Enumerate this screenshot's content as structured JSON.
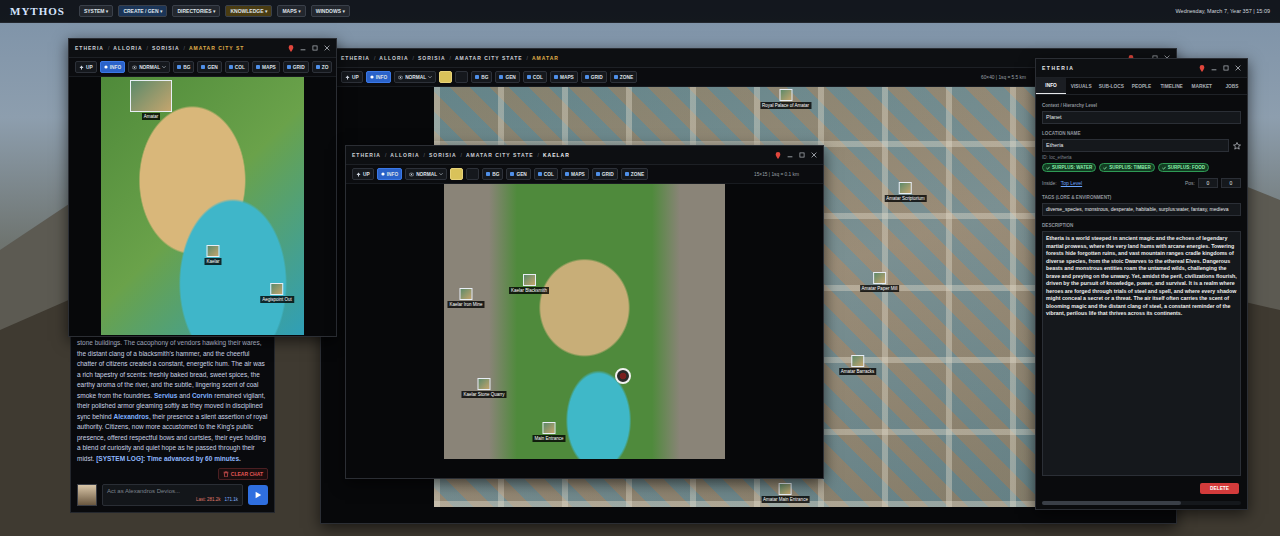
{
  "menubar": {
    "logo": "MYTHOS",
    "menus": [
      {
        "label": "SYSTEM ▾",
        "color": "#23272e"
      },
      {
        "label": "CREATE / GEN ▾",
        "color": "#1b3558"
      },
      {
        "label": "DIRECTORIES ▾",
        "color": "#23272e"
      },
      {
        "label": "KNOWLEDGE ▾",
        "color": "#4a3c12"
      },
      {
        "label": "MAPS ▾",
        "color": "#23272e"
      },
      {
        "label": "WINDOWS ▾",
        "color": "#23272e"
      }
    ],
    "clock": "Wednesday, March 7, Year 357 | 15:09"
  },
  "map_windows": [
    {
      "separator": "/",
      "crumbs": [
        "ETHERIA",
        "ALLORIA",
        "SORISIA",
        "AMATAR CITY ST"
      ],
      "toolbar": [
        {
          "label": "UP",
          "kind": "nav",
          "selected": false
        },
        {
          "label": "INFO",
          "kind": "toggle",
          "selected": true
        },
        {
          "label": "NORMAL",
          "kind": "dropdown",
          "selected": false
        },
        {
          "label": "BG",
          "kind": "tool",
          "selected": false
        },
        {
          "label": "GEN",
          "kind": "tool",
          "selected": false
        },
        {
          "label": "COL",
          "kind": "tool",
          "selected": false
        },
        {
          "label": "MAPS",
          "kind": "tool",
          "selected": false
        },
        {
          "label": "GRID",
          "kind": "tool",
          "selected": false
        },
        {
          "label": "ZO",
          "kind": "tool",
          "selected": false
        }
      ],
      "pins": [
        {
          "kind": "place",
          "label": "Amatar"
        },
        {
          "kind": "place",
          "label": "Kaelar"
        },
        {
          "kind": "place",
          "label": "Aegispoint Out"
        }
      ]
    },
    {
      "separator": "/",
      "crumbs": [
        "ETHERIA",
        "ALLORIA",
        "SORISIA",
        "AMATAR CITY STATE",
        "AMATAR"
      ],
      "toolbar": [
        {
          "label": "UP",
          "kind": "nav",
          "selected": false
        },
        {
          "label": "INFO",
          "kind": "toggle",
          "selected": true
        },
        {
          "label": "NORMAL",
          "kind": "dropdown",
          "selected": false
        },
        {
          "label": "",
          "kind": "icon",
          "selected": true
        },
        {
          "label": "",
          "kind": "icon",
          "selected": false
        },
        {
          "label": "BG",
          "kind": "tool",
          "selected": false
        },
        {
          "label": "GEN",
          "kind": "tool",
          "selected": false
        },
        {
          "label": "COL",
          "kind": "tool",
          "selected": false
        },
        {
          "label": "MAPS",
          "kind": "tool",
          "selected": false
        },
        {
          "label": "GRID",
          "kind": "tool",
          "selected": false
        },
        {
          "label": "ZONE",
          "kind": "tool",
          "selected": false
        }
      ],
      "scale": "60×40 | 1sq = 5.5 km",
      "pins": [
        {
          "kind": "place",
          "label": "Royal Palace of Amatar"
        },
        {
          "kind": "place",
          "label": "Amatar Scriptorium"
        },
        {
          "kind": "place",
          "label": "Amatar Paper Mill"
        },
        {
          "kind": "place",
          "label": "Amatar Barracks"
        },
        {
          "kind": "place",
          "label": "Amatar Main Entrance"
        }
      ]
    },
    {
      "separator": "/",
      "crumbs": [
        "ETHERIA",
        "ALLORIA",
        "SORISIA",
        "AMATAR CITY STATE",
        "KAELAR"
      ],
      "toolbar": [
        {
          "label": "UP",
          "kind": "nav",
          "selected": false
        },
        {
          "label": "INFO",
          "kind": "toggle",
          "selected": true
        },
        {
          "label": "NORMAL",
          "kind": "dropdown",
          "selected": false
        },
        {
          "label": "",
          "kind": "icon",
          "selected": true
        },
        {
          "label": "",
          "kind": "icon",
          "selected": false
        },
        {
          "label": "BG",
          "kind": "tool",
          "selected": false
        },
        {
          "label": "GEN",
          "kind": "tool",
          "selected": false
        },
        {
          "label": "COL",
          "kind": "tool",
          "selected": false
        },
        {
          "label": "MAPS",
          "kind": "tool",
          "selected": false
        },
        {
          "label": "GRID",
          "kind": "tool",
          "selected": false
        },
        {
          "label": "ZONE",
          "kind": "tool",
          "selected": false
        }
      ],
      "scale": "15×15 | 1sq = 0.1 km",
      "pins": [
        {
          "kind": "place",
          "label": "Kaelar Blacksmith"
        },
        {
          "kind": "place",
          "label": "Kaelar Iron Mine"
        },
        {
          "kind": "place",
          "label": "Kaelar Stone Quarry"
        },
        {
          "kind": "place",
          "label": "Main Entrance"
        },
        {
          "kind": "token",
          "label": ""
        }
      ]
    }
  ],
  "chat": {
    "segments": [
      {
        "kind": "text",
        "text": "stone buildings. The cacophony of vendors hawking their wares, the distant clang of a blacksmith's hammer, and the cheerful chatter of citizens created a constant, energetic hum. The air was a rich tapestry of scents: freshly baked bread, sweet spices, the earthy aroma of the river, and the subtle, lingering scent of coal smoke from the foundries. "
      },
      {
        "kind": "name",
        "text": "Servius"
      },
      {
        "kind": "text",
        "text": " and "
      },
      {
        "kind": "name",
        "text": "Corvin"
      },
      {
        "kind": "text",
        "text": " remained vigilant, their polished armor gleaming softly as they moved in disciplined sync behind "
      },
      {
        "kind": "name",
        "text": "Alexandros"
      },
      {
        "kind": "text",
        "text": ", their presence a silent assertion of royal authority. Citizens, now more accustomed to the King's public presence, offered respectful bows and curtsies, their eyes holding a blend of curiosity and quiet hope as he passed through their midst. "
      },
      {
        "kind": "log",
        "text": "[SYSTEM LOG]: Time advanced by 60 minutes."
      }
    ],
    "clear": "CLEAR CHAT",
    "placeholder": "Act as Alexandros Devios...",
    "last": "Last: 281.2k",
    "tokens": "171.1k"
  },
  "location_panel": {
    "title": "ETHERIA",
    "tabs": [
      {
        "label": "INFO",
        "selected": true
      },
      {
        "label": "VISUALS",
        "selected": false
      },
      {
        "label": "SUB-LOCS",
        "selected": false
      },
      {
        "label": "PEOPLE",
        "selected": false
      },
      {
        "label": "TIMELINE",
        "selected": false
      },
      {
        "label": "MARKET",
        "selected": false
      },
      {
        "label": "JOBS",
        "selected": false
      }
    ],
    "context": {
      "label": "Context / Hierarchy Level",
      "value": "Planet"
    },
    "name": {
      "label": "LOCATION NAME",
      "value": "Etheria",
      "starred": false
    },
    "id": "ID: loc_etheria",
    "tags": [
      "SURPLUS: WATER",
      "SURPLUS: TIMBER",
      "SURPLUS: FOOD"
    ],
    "inside": {
      "label": "Inside:",
      "value": "Top Level"
    },
    "pos": {
      "label": "Pos:",
      "values": [
        "0",
        "0"
      ]
    },
    "lore": {
      "label": "TAGS (LORE & ENVIRONMENT)",
      "value": "diverse_species, monstrous, desperate, habitable, surplus:water, fantasy, medieva"
    },
    "description": {
      "label": "DESCRIPTION",
      "text": "Etheria is a world steeped in ancient magic and the echoes of legendary martial prowess, where the very land hums with arcane energies. Towering forests hide forgotten ruins, and vast mountain ranges cradle kingdoms of diverse species, from the stoic Dwarves to the ethereal Elves. Dangerous beasts and monstrous entities roam the untamed wilds, challenging the brave and preying on the unwary. Yet, amidst the peril, civilizations flourish, driven by the pursuit of knowledge, power, and survival. It is a realm where heroes are forged through trials of steel and spell, and where every shadow might conceal a secret or a threat. The air itself often carries the scent of blooming magic and the distant clang of steel, a constant reminder of the vibrant, perilous life that thrives across its continents."
    },
    "delete": "DELETE"
  }
}
